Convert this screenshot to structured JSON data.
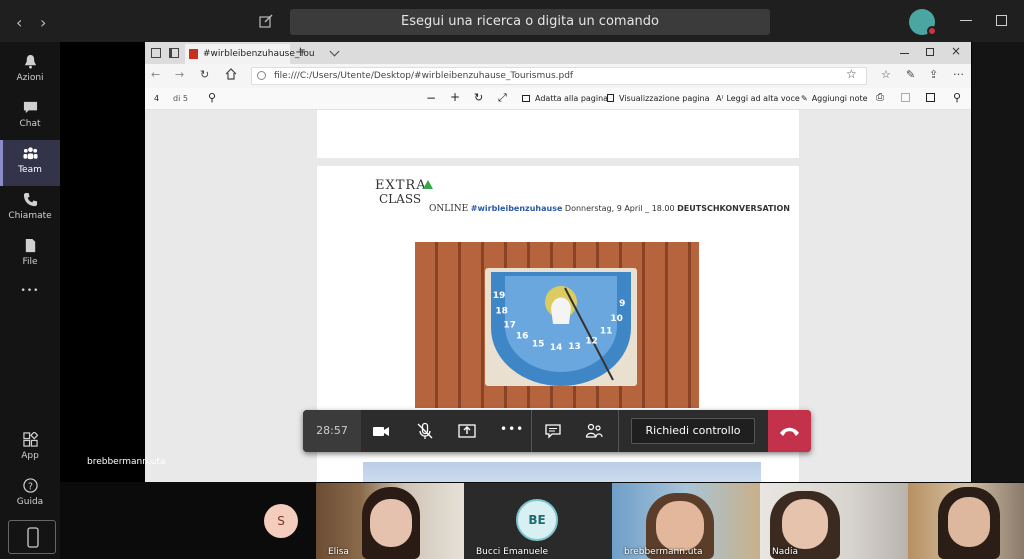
{
  "teams": {
    "search_placeholder": "Esegui una ricerca o digita un comando",
    "back_glyph": "‹",
    "forward_glyph": "›",
    "rail": [
      {
        "label": "Azioni",
        "icon": "bell-icon"
      },
      {
        "label": "Chat",
        "icon": "chat-icon"
      },
      {
        "label": "Team",
        "icon": "team-icon"
      },
      {
        "label": "Chiamate",
        "icon": "phone-icon"
      },
      {
        "label": "File",
        "icon": "file-icon"
      }
    ],
    "more_glyph": "•••",
    "bottom_rail": [
      {
        "label": "App",
        "icon": "apps-icon"
      },
      {
        "label": "Guida",
        "icon": "help-icon"
      }
    ]
  },
  "edge": {
    "tab_title": "#wirbleibenzuhause_Tou",
    "url": "file:///C:/Users/Utente/Desktop/#wirbleibenzuhause_Tourismus.pdf",
    "page_current": "4",
    "page_total": "di 5",
    "toolbar": {
      "fit_page": "Adatta alla pagina",
      "page_view": "Visualizzazione pagina",
      "read_aloud": "Leggi ad alta voce",
      "add_notes": "Aggiungi note"
    }
  },
  "pdf": {
    "logo_top": "EXTRA",
    "logo_bottom": "CLASS",
    "banner_online": "ONLINE",
    "banner_tag": "#wirbleibenzuhause",
    "banner_date": " Donnerstag, 9 April _ 18.00 ",
    "banner_topic": "DEUTSCHKONVERSATION",
    "sundial_numbers": [
      "9",
      "10",
      "11",
      "12",
      "13",
      "14",
      "15",
      "16",
      "17",
      "18",
      "19"
    ]
  },
  "call": {
    "timer": "28:57",
    "control_label": "Richiedi controllo",
    "presenter": "brebbermann.uta"
  },
  "participants": [
    {
      "name": "",
      "initial": "S"
    },
    {
      "name": "Elisa"
    },
    {
      "name": "Bucci Emanuele",
      "initial": "BE"
    },
    {
      "name": "brebbermann.uta"
    },
    {
      "name": "Nadia"
    },
    {
      "name": ""
    }
  ],
  "colors": {
    "accent": "#6264a7",
    "hangup": "#c4314b",
    "tag_blue": "#2a5aa8"
  }
}
